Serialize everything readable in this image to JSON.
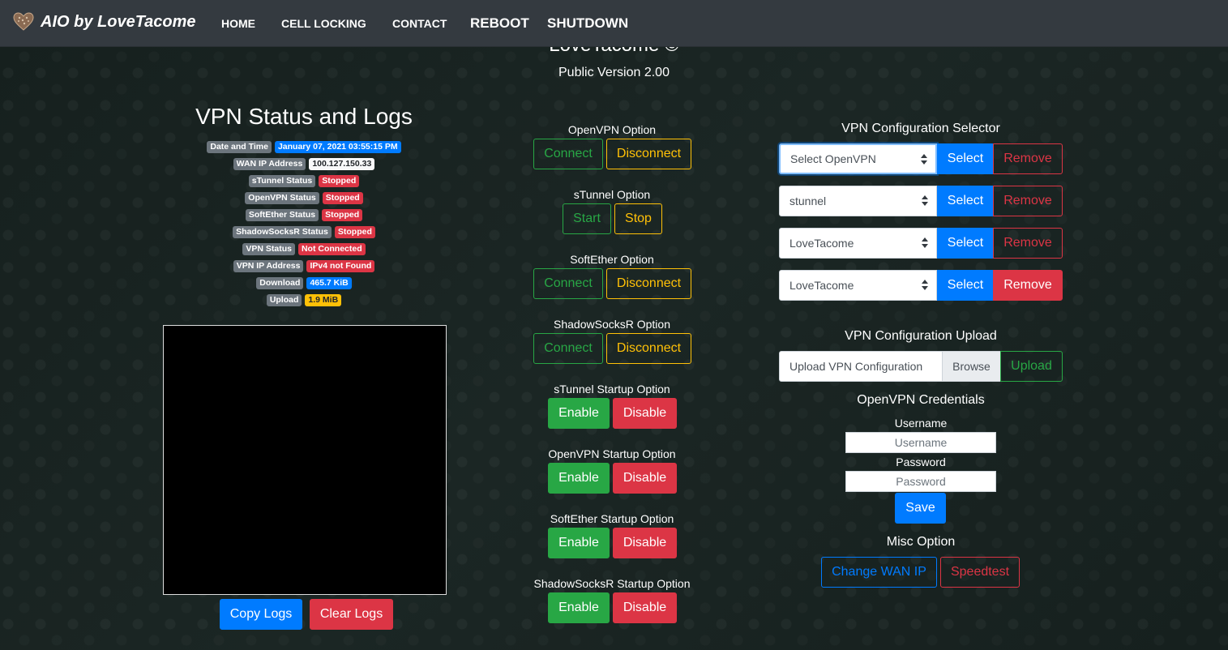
{
  "nav": {
    "brand": "AIO by LoveTacome",
    "links": [
      "HOME",
      "CELL LOCKING",
      "CONTACT",
      "REBOOT",
      "SHUTDOWN"
    ]
  },
  "header": {
    "title": "LoveTacome ©",
    "version": "Public Version 2.00"
  },
  "status": {
    "title": "VPN Status and Logs",
    "rows": [
      {
        "label": "Date and Time",
        "value": "January 07, 2021 03:55:15 PM"
      },
      {
        "label": "WAN IP Address",
        "value": "100.127.150.33"
      },
      {
        "label": "sTunnel Status",
        "value": "Stopped"
      },
      {
        "label": "OpenVPN Status",
        "value": "Stopped"
      },
      {
        "label": "SoftEther Status",
        "value": "Stopped"
      },
      {
        "label": "ShadowSocksR Status",
        "value": "Stopped"
      },
      {
        "label": "VPN Status",
        "value": "Not Connected"
      },
      {
        "label": "VPN IP Address",
        "value": "IPv4 not Found"
      },
      {
        "label": "Download",
        "value": "465.7 KiB"
      },
      {
        "label": "Upload",
        "value": "1.9 MiB"
      }
    ],
    "copy_logs": "Copy Logs",
    "clear_logs": "Clear Logs"
  },
  "options": {
    "openvpn": {
      "label": "OpenVPN Option",
      "connect": "Connect",
      "disconnect": "Disconnect"
    },
    "stunnel": {
      "label": "sTunnel Option",
      "start": "Start",
      "stop": "Stop"
    },
    "softether": {
      "label": "SoftEther Option",
      "connect": "Connect",
      "disconnect": "Disconnect"
    },
    "shadowsocksr": {
      "label": "ShadowSocksR Option",
      "connect": "Connect",
      "disconnect": "Disconnect"
    },
    "startup": [
      {
        "label": "sTunnel Startup Option",
        "enable": "Enable",
        "disable": "Disable"
      },
      {
        "label": "OpenVPN Startup Option",
        "enable": "Enable",
        "disable": "Disable"
      },
      {
        "label": "SoftEther Startup Option",
        "enable": "Enable",
        "disable": "Disable"
      },
      {
        "label": "ShadowSocksR Startup Option",
        "enable": "Enable",
        "disable": "Disable"
      }
    ]
  },
  "config_selector": {
    "title": "VPN Configuration Selector",
    "rows": [
      {
        "selected": "Select OpenVPN",
        "select": "Select",
        "remove": "Remove"
      },
      {
        "selected": "stunnel",
        "select": "Select",
        "remove": "Remove"
      },
      {
        "selected": "LoveTacome",
        "select": "Select",
        "remove": "Remove"
      },
      {
        "selected": "LoveTacome",
        "select": "Select",
        "remove": "Remove"
      }
    ]
  },
  "config_upload": {
    "title": "VPN Configuration Upload",
    "input_label": "Upload VPN Configuration",
    "browse": "Browse",
    "upload": "Upload"
  },
  "credentials": {
    "title": "OpenVPN Credentials",
    "username_label": "Username",
    "username_placeholder": "Username",
    "password_label": "Password",
    "password_placeholder": "Password",
    "save": "Save"
  },
  "misc": {
    "title": "Misc Option",
    "change_wan_ip": "Change WAN IP",
    "speedtest": "Speedtest"
  },
  "colors": {
    "primary": "#007bff",
    "danger": "#dc3545",
    "success": "#28a745",
    "warning": "#ffc107",
    "navbar": "#343a40"
  }
}
